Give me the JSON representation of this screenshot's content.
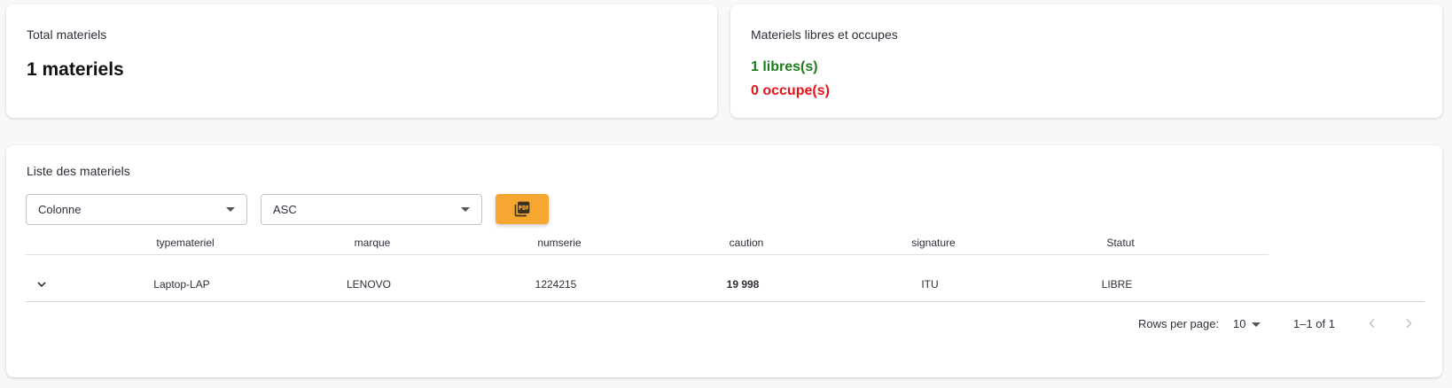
{
  "summary": {
    "total_title": "Total materiels",
    "total_value": "1 materiels",
    "status_title": "Materiels libres et occupes",
    "libres_text": "1 libres(s)",
    "occupes_text": "0 occupe(s)",
    "libres_color": "#1e7e1e",
    "occupes_color": "#e5141b"
  },
  "list": {
    "title": "Liste des materiels",
    "column_select_value": "Colonne",
    "order_select_value": "ASC",
    "pdf_button_icon": "pdf-icon",
    "accent_color": "#f5a731"
  },
  "table": {
    "headers": [
      "typemateriel",
      "marque",
      "numserie",
      "caution",
      "signature",
      "Statut"
    ],
    "rows": [
      {
        "typemateriel": "Laptop-LAP",
        "marque": "LENOVO",
        "numserie": "1224215",
        "caution": "19 998",
        "signature": "ITU",
        "statut": "LIBRE"
      }
    ]
  },
  "pagination": {
    "rows_per_page_label": "Rows per page:",
    "rows_per_page_value": "10",
    "range_text": "1–1 of 1"
  }
}
